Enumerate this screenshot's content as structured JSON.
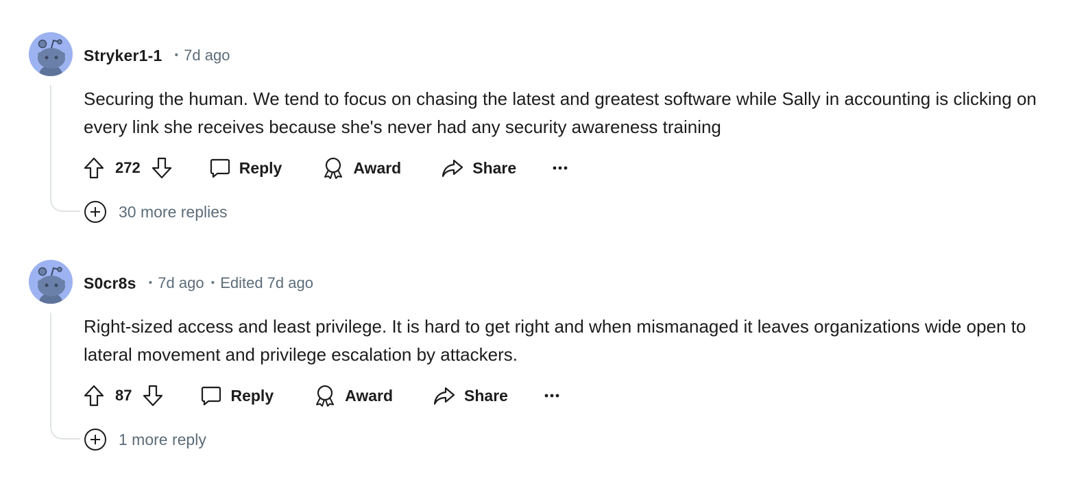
{
  "comments": [
    {
      "username": "Stryker1-1",
      "separator": "•",
      "timestamp": "7d ago",
      "edited": "",
      "body": "Securing the human. We tend to focus on chasing the latest and greatest software while Sally in accounting is clicking on every link she receives because she's never had any security awareness training",
      "score": "272",
      "reply_label": "Reply",
      "award_label": "Award",
      "share_label": "Share",
      "more_label": "···",
      "more_replies": "30 more replies"
    },
    {
      "username": "S0cr8s",
      "separator": "•",
      "timestamp": "7d ago",
      "edited_separator": "•",
      "edited": "Edited 7d ago",
      "body": "Right-sized access and least privilege. It is hard to get right and when mismanaged it leaves organizations wide open to lateral movement and privilege escalation by attackers.",
      "score": "87",
      "reply_label": "Reply",
      "award_label": "Award",
      "share_label": "Share",
      "more_label": "···",
      "more_replies": "1 more reply"
    }
  ],
  "icons": {
    "avatar": "snoo-avatar-icon",
    "upvote": "upvote-arrow-icon",
    "downvote": "downvote-arrow-icon",
    "reply": "speech-bubble-icon",
    "award": "award-ribbon-icon",
    "share": "share-arrow-icon",
    "more": "ellipsis-icon",
    "expand": "plus-circle-icon"
  },
  "colors": {
    "avatar_bg": "#9db2f0",
    "text": "#1c1c1c",
    "meta": "#5c6c78",
    "thread_line": "#dfe3e6"
  }
}
